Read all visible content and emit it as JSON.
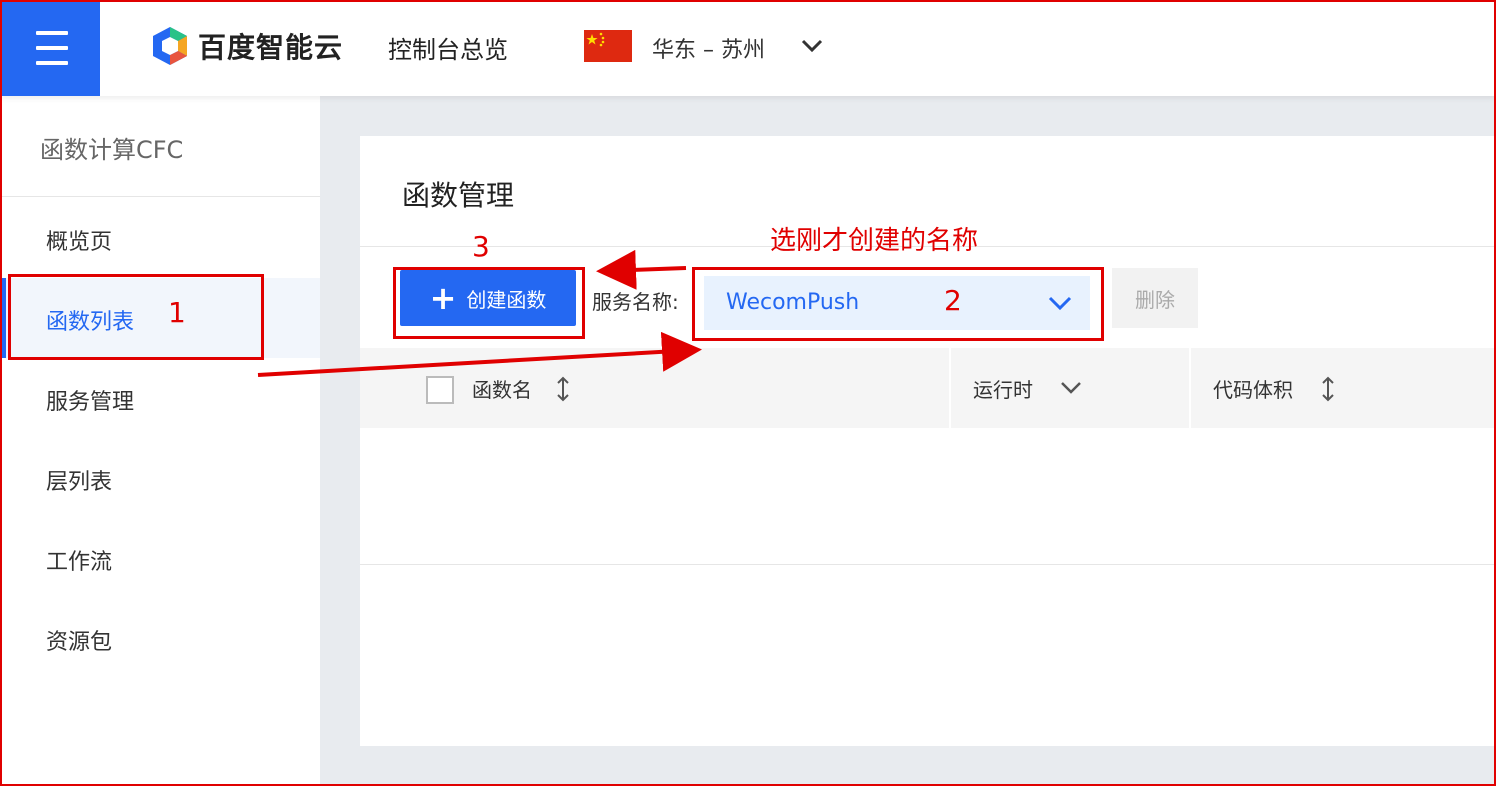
{
  "header": {
    "logo_text": "百度智能云",
    "console_title": "控制台总览",
    "region": "华东 – 苏州",
    "icons": [
      "menu-icon",
      "baidu-cloud-logo-icon",
      "china-flag-icon",
      "chevron-down-icon"
    ]
  },
  "sidebar": {
    "title": "函数计算CFC",
    "items": [
      {
        "label": "概览页",
        "active": false
      },
      {
        "label": "函数列表",
        "active": true
      },
      {
        "label": "服务管理",
        "active": false
      },
      {
        "label": "层列表",
        "active": false
      },
      {
        "label": "工作流",
        "active": false
      },
      {
        "label": "资源包",
        "active": false
      }
    ]
  },
  "main": {
    "title": "函数管理",
    "create_button": "创建函数",
    "service_label": "服务名称:",
    "service_value": "WecomPush",
    "delete_button": "删除",
    "columns": [
      {
        "label": "函数名",
        "icon": "sort-icon"
      },
      {
        "label": "运行时",
        "icon": "chevron-down-icon"
      },
      {
        "label": "代码体积",
        "icon": "sort-icon"
      }
    ]
  },
  "annotations": {
    "step1": "1",
    "step2": "2",
    "step3": "3",
    "hint": "选刚才创建的名称"
  },
  "colors": {
    "brand_blue": "#2468f2",
    "annotation_red": "#e00000"
  }
}
